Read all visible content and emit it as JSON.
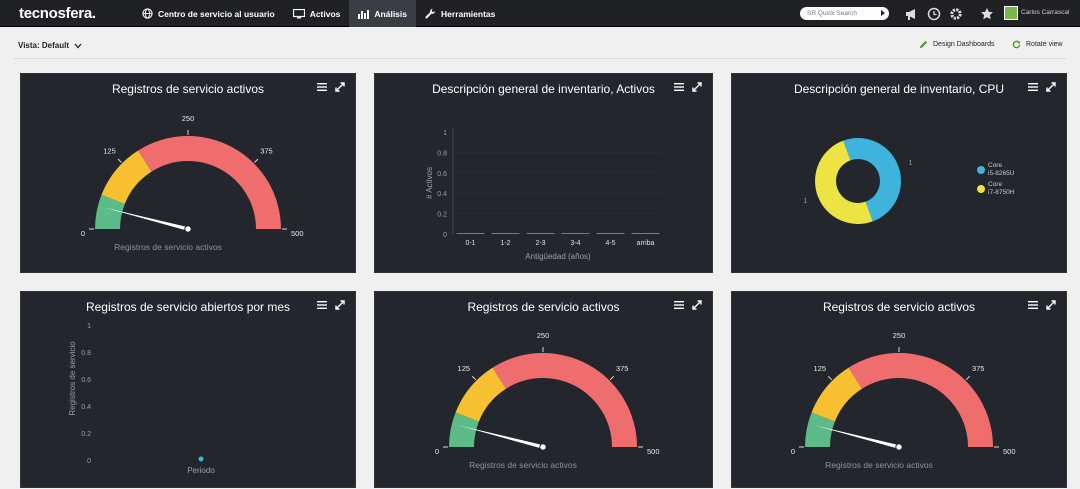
{
  "app": {
    "logo": "tecnosfera."
  },
  "nav": {
    "items": [
      {
        "label": "Centro de servicio al usuario",
        "icon": "globe-icon"
      },
      {
        "label": "Activos",
        "icon": "monitor-icon"
      },
      {
        "label": "Análisis",
        "icon": "bar-chart-icon",
        "active": true
      },
      {
        "label": "Herramientas",
        "icon": "wrench-icon"
      }
    ]
  },
  "search": {
    "placeholder": "SR Quick Search"
  },
  "user": {
    "name": "Carlos Carrascal"
  },
  "toolbar": {
    "view_label": "Vista: Default",
    "design_label": "Design Dashboards",
    "rotate_label": "Rotate view"
  },
  "colors": {
    "accent_green": "#4c9a2a",
    "gauge_green": "#5dbb8a",
    "gauge_yellow": "#f7c031",
    "gauge_red": "#ef6d6d",
    "donut_blue": "#3fb3dc",
    "donut_yellow": "#ede342"
  },
  "panels": {
    "p1": {
      "title": "Registros de servicio activos"
    },
    "p2": {
      "title": "Descripción general de inventario, Activos"
    },
    "p3": {
      "title": "Descripción general de inventario, CPU"
    },
    "p4": {
      "title": "Registros de servicio abiertos por mes"
    },
    "p5": {
      "title": "Registros de servicio activos"
    },
    "p6": {
      "title": "Registros de servicio activos"
    }
  },
  "chart_data": [
    {
      "id": "p1",
      "type": "gauge",
      "title": "Registros de servicio activos",
      "min": 0,
      "max": 500,
      "value": 40,
      "ticks": [
        0,
        125,
        250,
        375,
        500
      ],
      "bands": [
        {
          "from": 0,
          "to": 60,
          "color": "#5dbb8a"
        },
        {
          "from": 60,
          "to": 160,
          "color": "#f7c031"
        },
        {
          "from": 160,
          "to": 500,
          "color": "#ef6d6d"
        }
      ],
      "label": "Registros de servicio activos"
    },
    {
      "id": "p2",
      "type": "bar",
      "title": "Descripción general de inventario, Activos",
      "categories": [
        "0-1",
        "1-2",
        "2-3",
        "3-4",
        "4-5",
        "arriba"
      ],
      "values": [
        0,
        0,
        0,
        0,
        0,
        0
      ],
      "yticks": [
        "0",
        "0.2",
        "0.4",
        "0.6",
        "0.8",
        "1"
      ],
      "ylim": [
        0,
        1
      ],
      "xlabel": "Antigüedad (años)",
      "ylabel": "# Activos"
    },
    {
      "id": "p3",
      "type": "pie",
      "title": "Descripción general de inventario, CPU",
      "slices": [
        {
          "name": "Core i5-8265U",
          "value": 1,
          "color": "#3fb3dc"
        },
        {
          "name": "Core i7-8750H",
          "value": 1,
          "color": "#ede342"
        }
      ],
      "legend": "right"
    },
    {
      "id": "p4",
      "type": "scatter",
      "title": "Registros de servicio abiertos por mes",
      "points": [
        {
          "x": 0,
          "y": 0
        }
      ],
      "yticks": [
        "0",
        "0.2",
        "0.4",
        "0.6",
        "0.8",
        "1"
      ],
      "ylim": [
        0,
        1
      ],
      "xlabel": "Periodo",
      "ylabel": "Registros de servicio"
    },
    {
      "id": "p5",
      "type": "gauge",
      "title": "Registros de servicio activos",
      "min": 0,
      "max": 500,
      "value": 40,
      "ticks": [
        0,
        125,
        250,
        375,
        500
      ],
      "bands": [
        {
          "from": 0,
          "to": 60,
          "color": "#5dbb8a"
        },
        {
          "from": 60,
          "to": 160,
          "color": "#f7c031"
        },
        {
          "from": 160,
          "to": 500,
          "color": "#ef6d6d"
        }
      ],
      "label": "Registros de servicio activos"
    },
    {
      "id": "p6",
      "type": "gauge",
      "title": "Registros de servicio activos",
      "min": 0,
      "max": 500,
      "value": 40,
      "ticks": [
        0,
        125,
        250,
        375,
        500
      ],
      "bands": [
        {
          "from": 0,
          "to": 60,
          "color": "#5dbb8a"
        },
        {
          "from": 60,
          "to": 160,
          "color": "#f7c031"
        },
        {
          "from": 160,
          "to": 500,
          "color": "#ef6d6d"
        }
      ],
      "label": "Registros de servicio activos"
    }
  ]
}
